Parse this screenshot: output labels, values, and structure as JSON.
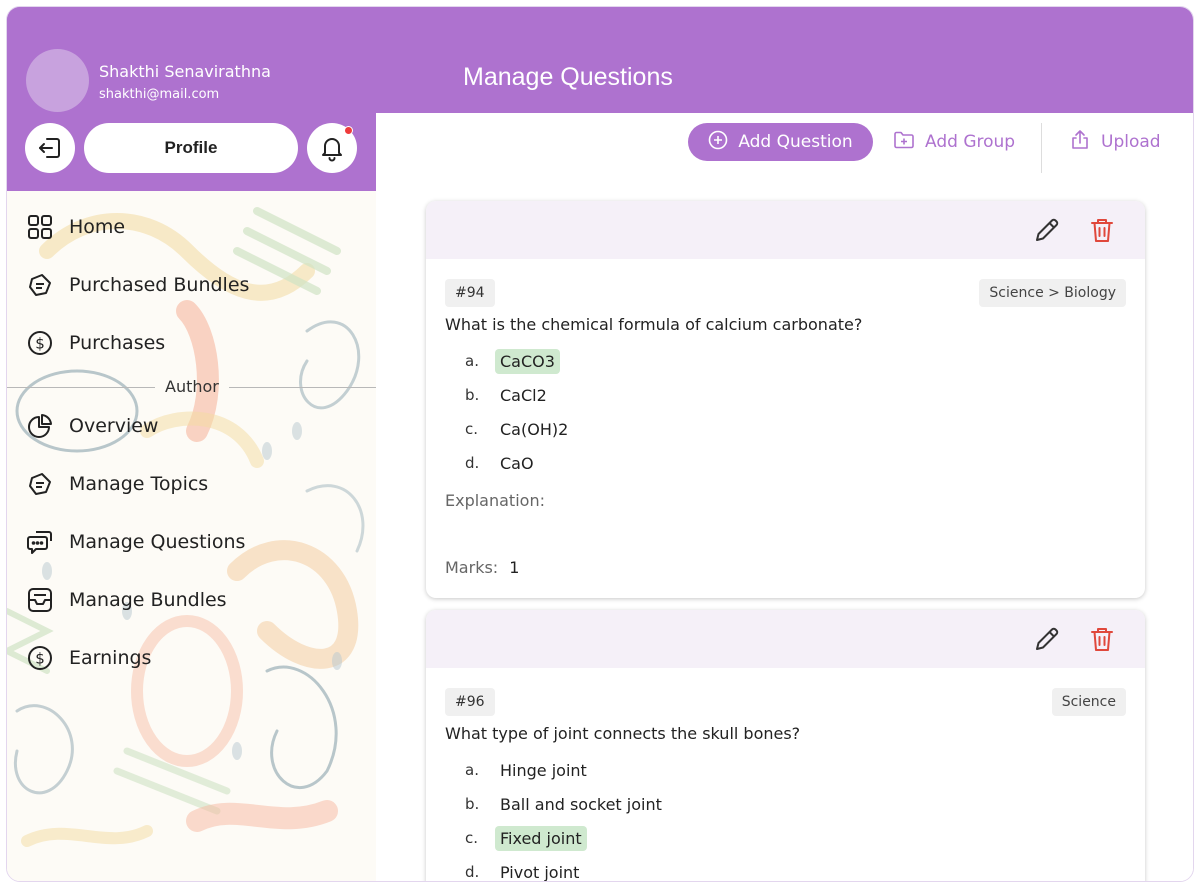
{
  "user": {
    "name": "Shakthi Senavirathna",
    "email": "shakthi@mail.com"
  },
  "profile_label": "Profile",
  "page_title": "Manage Questions",
  "nav": {
    "home": "Home",
    "purchased_bundles": "Purchased Bundles",
    "purchases": "Purchases",
    "author_label": "Author",
    "overview": "Overview",
    "manage_topics": "Manage Topics",
    "manage_questions": "Manage Questions",
    "manage_bundles": "Manage Bundles",
    "earnings": "Earnings"
  },
  "toolbar": {
    "add_question": "Add Question",
    "add_group": "Add Group",
    "upload": "Upload"
  },
  "colors": {
    "accent": "#ae72cf",
    "correct": "#cfe9cf",
    "delete": "#e0483c",
    "notification": "#ef3b3b"
  },
  "questions": [
    {
      "id": "#94",
      "category": "Science > Biology",
      "text": "What is the chemical formula of calcium carbonate?",
      "options": [
        {
          "letter": "a.",
          "text": "CaCO3",
          "correct": true
        },
        {
          "letter": "b.",
          "text": "CaCl2",
          "correct": false
        },
        {
          "letter": "c.",
          "text": "Ca(OH)2",
          "correct": false
        },
        {
          "letter": "d.",
          "text": "CaO",
          "correct": false
        }
      ],
      "explanation_label": "Explanation:",
      "marks_label": "Marks:",
      "marks": "1"
    },
    {
      "id": "#96",
      "category": "Science",
      "text": "What type of joint connects the skull bones?",
      "options": [
        {
          "letter": "a.",
          "text": "Hinge joint",
          "correct": false
        },
        {
          "letter": "b.",
          "text": "Ball and socket joint",
          "correct": false
        },
        {
          "letter": "c.",
          "text": "Fixed joint",
          "correct": true
        },
        {
          "letter": "d.",
          "text": "Pivot joint",
          "correct": false
        }
      ]
    }
  ]
}
